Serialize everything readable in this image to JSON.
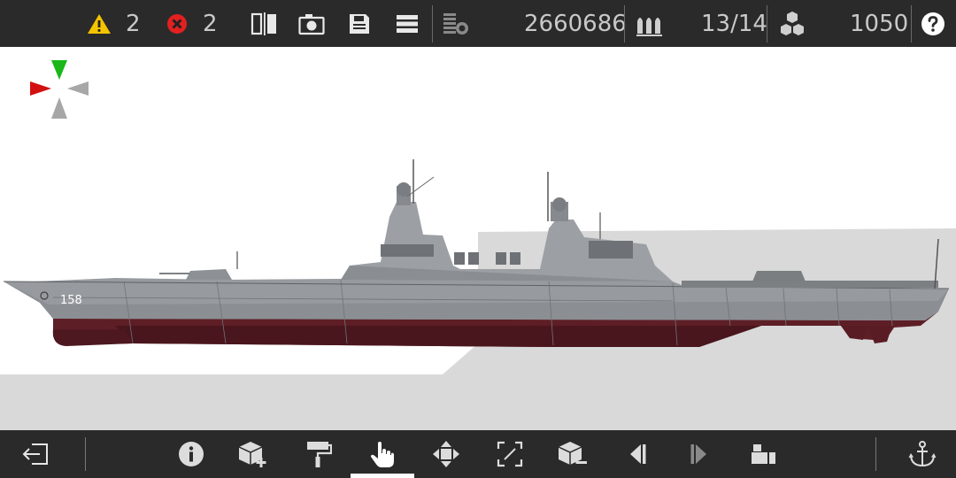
{
  "toolbar": {
    "warnings_count": "2",
    "errors_count": "2",
    "cost": "2660686",
    "crew_ratio": "13/14",
    "weight": "1050"
  },
  "ship": {
    "hull_number": "158"
  },
  "colors": {
    "bar_bg": "#2a2a2a",
    "hull_gray": "#8f9397",
    "hull_red": "#5e1e26",
    "warning_yellow": "#f5c400",
    "error_red": "#e22020",
    "gizmo_green": "#19b818",
    "gizmo_red": "#d21010"
  },
  "bottom_tools": [
    {
      "name": "exit-icon"
    },
    {
      "name": "info-icon"
    },
    {
      "name": "add-part-icon"
    },
    {
      "name": "paint-roller-icon"
    },
    {
      "name": "hand-pointer-icon",
      "active": true
    },
    {
      "name": "move-icon"
    },
    {
      "name": "resize-icon"
    },
    {
      "name": "remove-part-icon"
    },
    {
      "name": "previous-icon"
    },
    {
      "name": "next-icon"
    },
    {
      "name": "duplicate-icon"
    },
    {
      "name": "anchor-icon"
    }
  ]
}
